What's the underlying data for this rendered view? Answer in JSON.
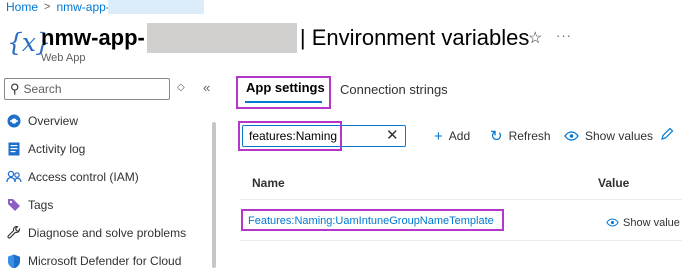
{
  "breadcrumb": {
    "home": "Home",
    "separator": ">",
    "app": "nmw-app-"
  },
  "header": {
    "icon_text": "{x}",
    "app_name": "nmw-app-",
    "page_title": "| Environment variables",
    "subtitle": "Web App",
    "favorite_icon": "☆",
    "more_icon": "···"
  },
  "sidebar": {
    "search_placeholder": "Search",
    "items": [
      {
        "label": "Overview",
        "icon": "overview-icon"
      },
      {
        "label": "Activity log",
        "icon": "activity-log-icon"
      },
      {
        "label": "Access control (IAM)",
        "icon": "people-icon"
      },
      {
        "label": "Tags",
        "icon": "tag-icon"
      },
      {
        "label": "Diagnose and solve problems",
        "icon": "wrench-icon"
      },
      {
        "label": "Microsoft Defender for Cloud",
        "icon": "shield-icon"
      }
    ]
  },
  "tabs": {
    "app_settings": "App settings",
    "connection_strings": "Connection strings"
  },
  "toolbar": {
    "filter_value": "features:Naming",
    "add": "Add",
    "refresh": "Refresh",
    "show_values": "Show values"
  },
  "table": {
    "columns": {
      "name": "Name",
      "value": "Value"
    },
    "rows": [
      {
        "name": "Features:Naming:UamIntuneGroupNameTemplate",
        "value_action": "Show value"
      }
    ]
  },
  "colors": {
    "accent": "#0078d4",
    "highlight": "#b337c9",
    "redaction": "#d2d0ce"
  }
}
